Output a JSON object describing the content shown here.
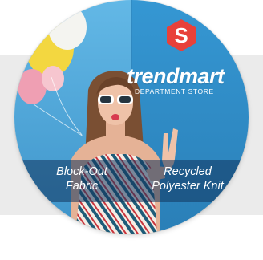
{
  "background": {
    "band_color": "#ebebeb",
    "page_color": "#ffffff"
  },
  "sign": {
    "logo_letter": "S",
    "logo_color": "#e8413a",
    "brand": "trendmart",
    "tagline": "DEPARTMENT STORE",
    "wall_left_color": "#4aa8d8",
    "wall_right_color": "#2f8ac4"
  },
  "captions": {
    "left": "Block-Out\nFabric",
    "right": "Recycled\nPolyester Knit",
    "band_color": "#12345c"
  },
  "illustration": {
    "subject": "woman with white sunglasses blowing a kiss and making a peace sign",
    "balloons": [
      "yellow",
      "pink",
      "white"
    ],
    "dress_pattern": "diagonal stripes"
  }
}
